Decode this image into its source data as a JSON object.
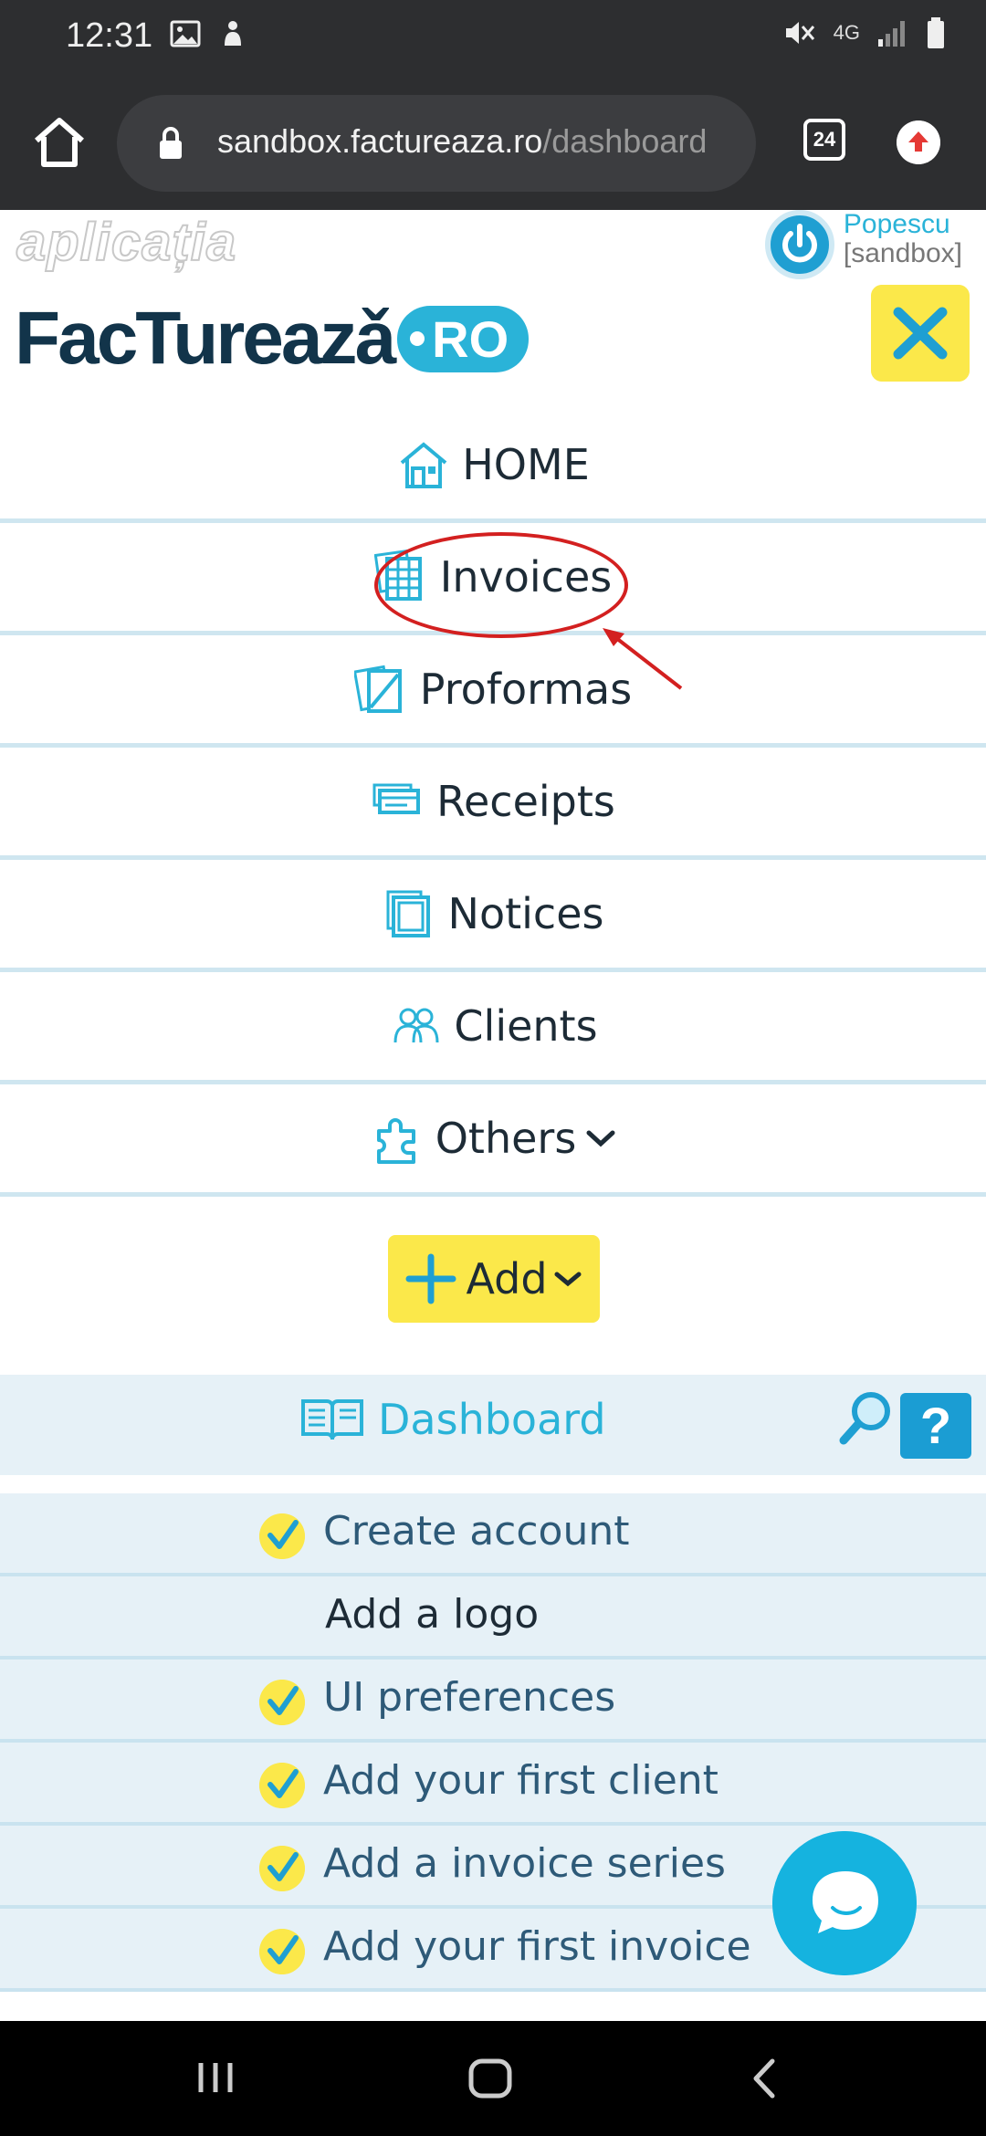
{
  "status_bar": {
    "time": "12:31",
    "network": "4G",
    "icons": [
      "image-icon",
      "notification-icon",
      "mute-icon",
      "signal-icon",
      "battery-icon"
    ]
  },
  "browser": {
    "url_main": "sandbox.factureaza.ro",
    "url_rest": "/dashboard",
    "tab_count": "24"
  },
  "header": {
    "watermark": "aplicația",
    "logo_word": "FacTureazǎ",
    "logo_suffix": "RO",
    "user_name": "Popescu",
    "user_env": "[sandbox]"
  },
  "menu": {
    "items": [
      {
        "label": "HOME",
        "icon": "home-icon"
      },
      {
        "label": "Invoices",
        "icon": "invoices-icon"
      },
      {
        "label": "Proformas",
        "icon": "proformas-icon"
      },
      {
        "label": "Receipts",
        "icon": "receipts-icon"
      },
      {
        "label": "Notices",
        "icon": "notices-icon"
      },
      {
        "label": "Clients",
        "icon": "clients-icon"
      },
      {
        "label": "Others",
        "icon": "puzzle-icon"
      }
    ],
    "add_label": "Add"
  },
  "dashboard": {
    "title": "Dashboard",
    "help": "?"
  },
  "checklist": [
    {
      "label": "Create account",
      "done": true
    },
    {
      "label": "Add a logo",
      "done": false
    },
    {
      "label": "UI preferences",
      "done": true
    },
    {
      "label": "Add your first client",
      "done": true
    },
    {
      "label": "Add a invoice series",
      "done": true
    },
    {
      "label": "Add your first invoice",
      "done": true
    }
  ],
  "colors": {
    "accent": "#2ab3d8",
    "yellow": "#fbe84a",
    "navy": "#12344a",
    "annotation_red": "#d32020",
    "panel": "#e6f1f7"
  }
}
